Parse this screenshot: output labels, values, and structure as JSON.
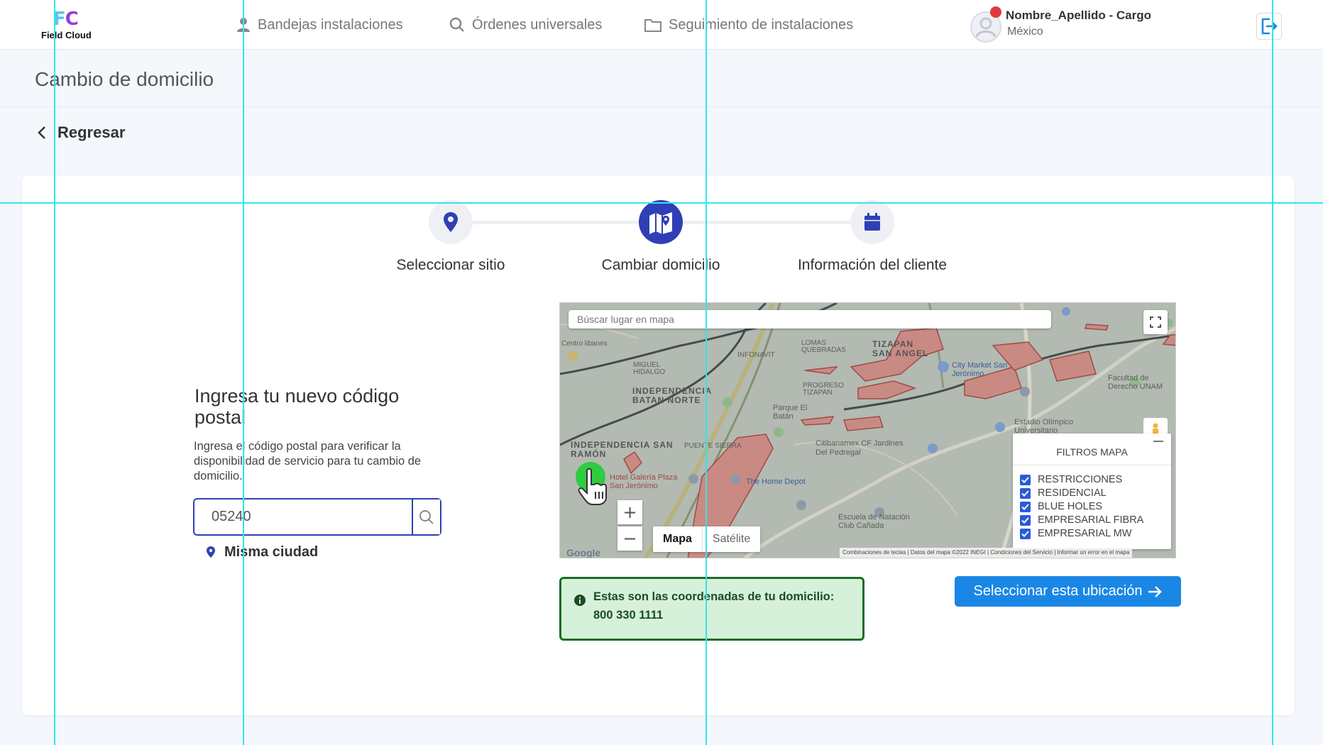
{
  "header": {
    "logo_name": "Field Cloud",
    "logo_mark": "FC",
    "nav": [
      {
        "label": "Bandejas instalaciones",
        "icon": "user-icon"
      },
      {
        "label": "Órdenes universales",
        "icon": "search-icon"
      },
      {
        "label": "Seguimiento de instalaciones",
        "icon": "folder-icon"
      }
    ],
    "user": {
      "name": "Nombre_Apellido - Cargo",
      "country": "México"
    },
    "logout_icon": "logout-icon"
  },
  "page": {
    "title": "Cambio de domicilio",
    "back_label": "Regresar"
  },
  "stepper": {
    "steps": [
      {
        "label": "Seleccionar sitio",
        "icon": "map-pin-icon",
        "active": false
      },
      {
        "label": "Cambiar domicilio",
        "icon": "map-icon",
        "active": true
      },
      {
        "label": "Información del cliente",
        "icon": "calendar-icon",
        "active": false
      }
    ]
  },
  "zip_form": {
    "title": "Ingresa tu nuevo código postal",
    "description": "Ingresa el código postal para verificar la disponibilidad de servicio para tu cambio de domicilio.",
    "value": "05240",
    "same_city_label": "Misma ciudad"
  },
  "map": {
    "search_placeholder": "Búscar lugar en mapa",
    "filters_title": "FILTROS MAPA",
    "filters": [
      {
        "label": "RESTRICCIONES",
        "checked": true
      },
      {
        "label": "RESIDENCIAL",
        "checked": true
      },
      {
        "label": "BLUE HOLES",
        "checked": true
      },
      {
        "label": "EMPRESARIAL FIBRA",
        "checked": true
      },
      {
        "label": "EMPRESARIAL MW",
        "checked": true
      }
    ],
    "zoom_in": "+",
    "zoom_out": "−",
    "type_map": "Mapa",
    "type_satellite": "Satélite",
    "google": "Google",
    "attribution": "Combinaciones de teclas | Datos del mapa ©2022 INEGI | Condiciones del Servicio | Informar un error en el mapa",
    "labels": {
      "centro_libanes": "Centro libanes",
      "infonavit": "INFONAVIT",
      "miguel_hidalgo": "MIGUEL HIDALGO",
      "independencia_batan_norte": "INDEPENDENCIA BATAN NORTE",
      "independencia_san_ramon": "INDEPENDENCIA SAN RAMÓN",
      "tizapan": "TIZAPAN SAN ANGEL",
      "progreso_tizapan": "PROGRESO TIZAPAN",
      "lomas_quebradas": "LOMAS QUEBRADAS",
      "parque_el_batan": "Parque El Batán",
      "estadio": "Estadio Olímpico Universitario",
      "facultad_derecho": "Facultad de Derecho UNAM",
      "citibanamex": "Citibanamex CF Jardines Del Pedregal",
      "home_depot": "The Home Depot",
      "hotel": "Hotel Galería Plaza San Jerónimo",
      "escuela": "Escuela de Natación Club Cañada",
      "city_market": "City Market San Jerónimo",
      "puente_sierra": "PUENTE SIERRA"
    }
  },
  "coordinates": {
    "title": "Estas son las coordenadas de tu domicilio:",
    "value": "800 330 1111"
  },
  "select_button": "Seleccionar esta ubicación",
  "colors": {
    "primary": "#2f3fb5",
    "button_blue": "#1a87e6",
    "success_bg": "#d6f0da",
    "success_border": "#1e6b2a",
    "guide": "#2ee6ee"
  }
}
